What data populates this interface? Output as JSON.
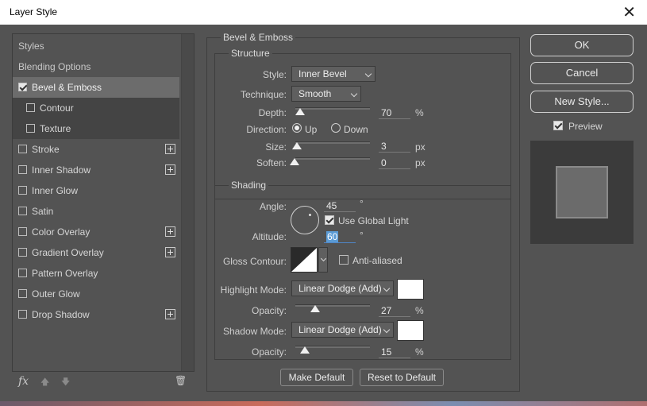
{
  "window": {
    "title": "Layer Style",
    "close_glyph": "✕"
  },
  "sidebar": {
    "items": [
      {
        "label": "Styles",
        "type": "header"
      },
      {
        "label": "Blending Options",
        "type": "header"
      },
      {
        "label": "Bevel & Emboss",
        "checked": true,
        "selected": true
      },
      {
        "label": "Contour",
        "checked": false,
        "sub": true
      },
      {
        "label": "Texture",
        "checked": false,
        "sub": true
      },
      {
        "label": "Stroke",
        "checked": false,
        "plus": true
      },
      {
        "label": "Inner Shadow",
        "checked": false,
        "plus": true
      },
      {
        "label": "Inner Glow",
        "checked": false
      },
      {
        "label": "Satin",
        "checked": false
      },
      {
        "label": "Color Overlay",
        "checked": false,
        "plus": true
      },
      {
        "label": "Gradient Overlay",
        "checked": false,
        "plus": true
      },
      {
        "label": "Pattern Overlay",
        "checked": false
      },
      {
        "label": "Outer Glow",
        "checked": false
      },
      {
        "label": "Drop Shadow",
        "checked": false,
        "plus": true
      }
    ],
    "footer": {
      "fx": "fx",
      "up": "🡅",
      "down": "🡇",
      "trash": "🗑"
    }
  },
  "bevel": {
    "section_title": "Bevel & Emboss",
    "structure": {
      "title": "Structure",
      "style_label": "Style:",
      "style_value": "Inner Bevel",
      "technique_label": "Technique:",
      "technique_value": "Smooth",
      "depth_label": "Depth:",
      "depth_value": "70",
      "depth_unit": "%",
      "direction_label": "Direction:",
      "direction_up": "Up",
      "direction_down": "Down",
      "size_label": "Size:",
      "size_value": "3",
      "size_unit": "px",
      "soften_label": "Soften:",
      "soften_value": "0",
      "soften_unit": "px"
    },
    "shading": {
      "title": "Shading",
      "angle_label": "Angle:",
      "angle_value": "45",
      "degree": "°",
      "global_light_label": "Use Global Light",
      "altitude_label": "Altitude:",
      "altitude_value": "60",
      "gloss_label": "Gloss Contour:",
      "anti_aliased_label": "Anti-aliased",
      "highlight_label": "Highlight Mode:",
      "highlight_value": "Linear Dodge (Add)",
      "highlight_opacity_label": "Opacity:",
      "highlight_opacity_value": "27",
      "shadow_label": "Shadow Mode:",
      "shadow_value": "Linear Dodge (Add)",
      "shadow_opacity_label": "Opacity:",
      "shadow_opacity_value": "15",
      "percent": "%"
    },
    "make_default": "Make Default",
    "reset_default": "Reset to Default"
  },
  "actions": {
    "ok": "OK",
    "cancel": "Cancel",
    "new_style": "New Style...",
    "preview_label": "Preview"
  },
  "colors": {
    "highlight_color": "#ffffff",
    "shadow_color": "#ffffff"
  }
}
